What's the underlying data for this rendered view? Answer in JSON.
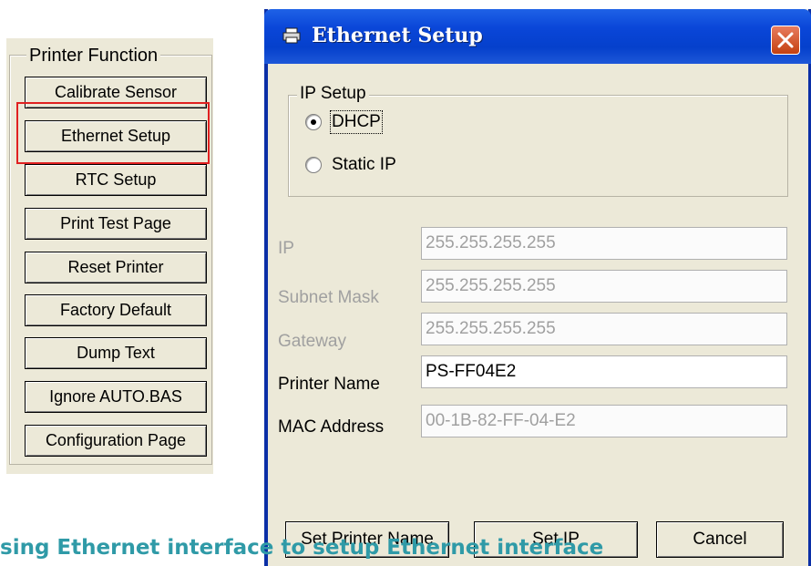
{
  "printer_function": {
    "title": "Printer Function",
    "buttons": [
      "Calibrate Sensor",
      "Ethernet Setup",
      "RTC Setup",
      "Print Test Page",
      "Reset Printer",
      "Factory Default",
      "Dump Text",
      "Ignore AUTO.BAS",
      "Configuration Page"
    ]
  },
  "dialog": {
    "title": "Ethernet Setup",
    "ip_setup": {
      "legend": "IP Setup",
      "options": [
        "DHCP",
        "Static IP"
      ],
      "selected": "DHCP"
    },
    "fields": {
      "ip": {
        "label": "IP",
        "value": "255.255.255.255"
      },
      "subnet": {
        "label": "Subnet Mask",
        "value": "255.255.255.255"
      },
      "gateway": {
        "label": "Gateway",
        "value": "255.255.255.255"
      },
      "printer_name": {
        "label": "Printer Name",
        "value": "PS-FF04E2"
      },
      "mac": {
        "label": "MAC Address",
        "value": "00-1B-82-FF-04-E2"
      }
    },
    "buttons": {
      "set_printer_name": "Set Printer Name",
      "set_ip": "Set IP",
      "cancel": "Cancel"
    }
  },
  "caption": "sing Ethernet interface to setup Ethernet interface",
  "colors": {
    "title_bar": "#0a46d8",
    "highlight": "#e02020",
    "caption": "#2f9aa7",
    "dialog_bg": "#ece9d8"
  }
}
